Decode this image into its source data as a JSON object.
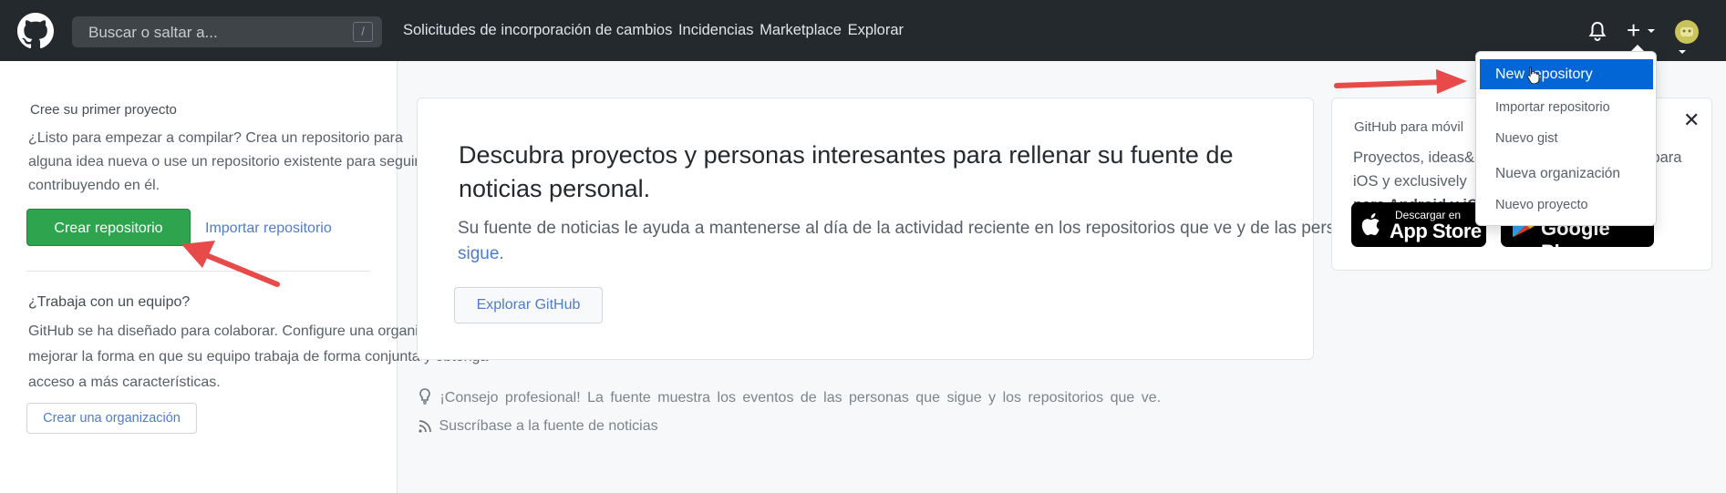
{
  "header": {
    "search_placeholder": "Buscar o saltar a...",
    "slash_hint": "/",
    "nav": [
      "Solicitudes de incorporación de cambios",
      "Incidencias",
      "Marketplace",
      "Explorar"
    ],
    "plus": "+"
  },
  "sidebar": {
    "first_project_title": "Cree su primer proyecto",
    "first_project_text": "¿Listo para empezar a compilar? Crea un repositorio para alguna idea nueva o use un repositorio existente para seguir contribuyendo en él.",
    "create_repo_button": "Crear repositorio",
    "import_repo_link": "Importar repositorio",
    "team_title": "¿Trabaja con un equipo?",
    "team_text": "GitHub se ha diseñado para colaborar. Configure una organización para mejorar la forma en que su equipo trabaja de forma conjunta y obtenga acceso a más características.",
    "create_org_button": "Crear una organización"
  },
  "main": {
    "heading": "Descubra proyectos y personas interesantes para rellenar su fuente de noticias personal.",
    "paragraph": "Su fuente de noticias le ayuda a mantenerse al día de la actividad reciente en los repositorios que ve y de las personas que",
    "paragraph_link": "sigue.",
    "explore_button": "Explorar GitHub",
    "tip": "¡Consejo profesional! La fuente muestra los eventos de las personas que sigue y los repositorios que ve.",
    "subscribe": "Suscríbase a la fuente de noticias"
  },
  "mobile": {
    "title": "GitHub para móvil",
    "text_start": "Proyectos, ideas",
    "text_end": "& código para llevar. Nativo para iOS y exclusively",
    "text_bold": "para Android y iOS.",
    "close": "✕",
    "appstore_small": "Descargar en",
    "appstore_big": "App Store",
    "googleplay_big": "Google Play"
  },
  "dropdown": {
    "items": [
      "New repository",
      "Importar repositorio",
      "Nuevo gist",
      "Nueva organización",
      "Nuevo proyecto"
    ]
  },
  "colors": {
    "header_bg": "#24292e",
    "accent_green": "#2ea44f",
    "link_blue": "#4f7ccc",
    "dropdown_active": "#0366d6",
    "annotation_arrow": "#e84a4a"
  }
}
